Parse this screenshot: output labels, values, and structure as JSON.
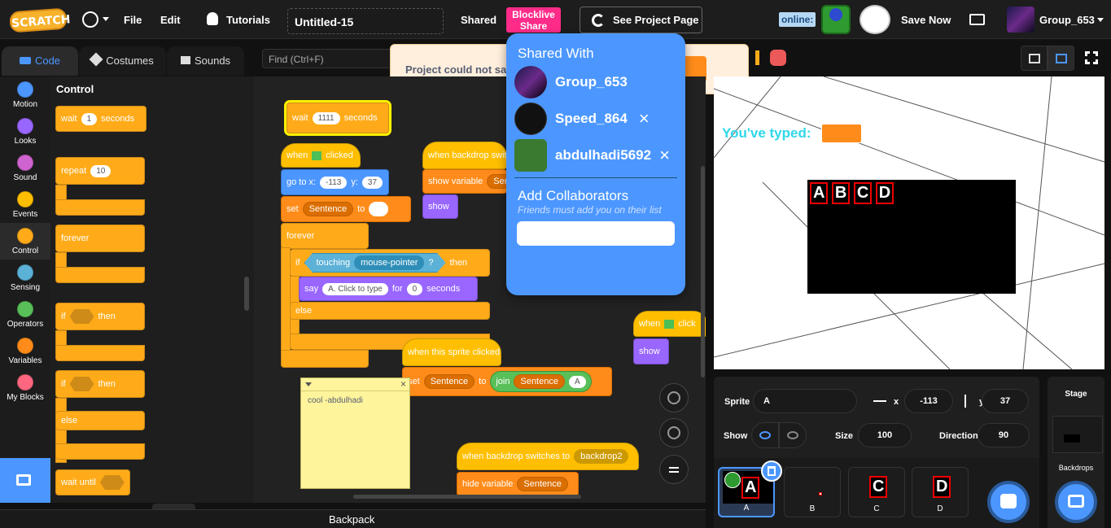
{
  "menubar": {
    "logo": "SCRATCH",
    "file": "File",
    "edit": "Edit",
    "tutorials": "Tutorials",
    "project_title": "Untitled-15",
    "shared": "Shared",
    "blocklive_share_1": "Blocklive",
    "blocklive_share_2": "Share",
    "see_project": "See Project Page",
    "online": "online:",
    "save_now": "Save Now",
    "username": "Group_653"
  },
  "tabs": {
    "code": "Code",
    "costumes": "Costumes",
    "sounds": "Sounds"
  },
  "find_placeholder": "Find (Ctrl+F)",
  "alert": {
    "text": "Project could not sa"
  },
  "categories": [
    {
      "label": "Motion",
      "color": "#4c97ff"
    },
    {
      "label": "Looks",
      "color": "#9966ff"
    },
    {
      "label": "Sound",
      "color": "#cf63cf"
    },
    {
      "label": "Events",
      "color": "#ffbf00"
    },
    {
      "label": "Control",
      "color": "#ffab19"
    },
    {
      "label": "Sensing",
      "color": "#5cb1d6"
    },
    {
      "label": "Operators",
      "color": "#59c059"
    },
    {
      "label": "Variables",
      "color": "#ff8c1a"
    },
    {
      "label": "My Blocks",
      "color": "#ff6680"
    }
  ],
  "palette": {
    "heading": "Control",
    "wait": "wait",
    "wait_val": "1",
    "seconds": "seconds",
    "repeat": "repeat",
    "repeat_val": "10",
    "forever": "forever",
    "if": "if",
    "then": "then",
    "if2": "if",
    "then2": "then",
    "else": "else",
    "wait_until": "wait until"
  },
  "script": {
    "wait": "wait",
    "wait_val": "1111",
    "seconds": "seconds",
    "when": "when",
    "clicked": "clicked",
    "goto": "go to x:",
    "x_val": "-113",
    "y_label": "y:",
    "y_val": "37",
    "set": "set",
    "sentence": "Sentence",
    "to": "to",
    "forever": "forever",
    "if": "if",
    "touching": "touching",
    "mouse_pointer": "mouse-pointer",
    "q": "?",
    "then": "then",
    "say": "say",
    "say_text": "A. Click to type",
    "for": "for",
    "say_secs": "0",
    "seconds2": "seconds",
    "else": "else",
    "when_backdrop": "when backdrop switc",
    "show_variable": "show variable",
    "sen_short": "Sen",
    "show": "show",
    "when_sprite_clicked": "when this sprite clicked",
    "set2": "set",
    "sentence2": "Sentence",
    "to2": "to",
    "join": "join",
    "sentence3": "Sentence",
    "join_a": "A",
    "note": "cool -abdulhadi",
    "when_backdrop2": "when backdrop switches to",
    "backdrop2": "backdrop2",
    "hide_variable": "hide variable",
    "sentence4": "Sentence",
    "when3": "when",
    "clicked3": "click",
    "show3": "show"
  },
  "search_tooltip": "Search",
  "backpack": "Backpack",
  "popup": {
    "shared_with": "Shared With",
    "collaborators": [
      "Group_653",
      "Speed_864",
      "abdulhadi5692"
    ],
    "add_title": "Add Collaborators",
    "add_subtitle": "Friends must add you on their list"
  },
  "stage": {
    "typed_label": "You've typed:",
    "letters": [
      "A",
      "B",
      "C",
      "D"
    ]
  },
  "sprite_info": {
    "sprite_label": "Sprite",
    "sprite_name": "A",
    "x_label": "x",
    "x_val": "-113",
    "y_label": "y",
    "y_val": "37",
    "show_label": "Show",
    "size_label": "Size",
    "size_val": "100",
    "direction_label": "Direction",
    "direction_val": "90"
  },
  "sprites": [
    {
      "name": "A",
      "letter": "A"
    },
    {
      "name": "B",
      "letter": ""
    },
    {
      "name": "C",
      "letter": "C"
    },
    {
      "name": "D",
      "letter": "D"
    }
  ],
  "stage_panel": {
    "label": "Stage",
    "backdrops": "Backdrops"
  }
}
